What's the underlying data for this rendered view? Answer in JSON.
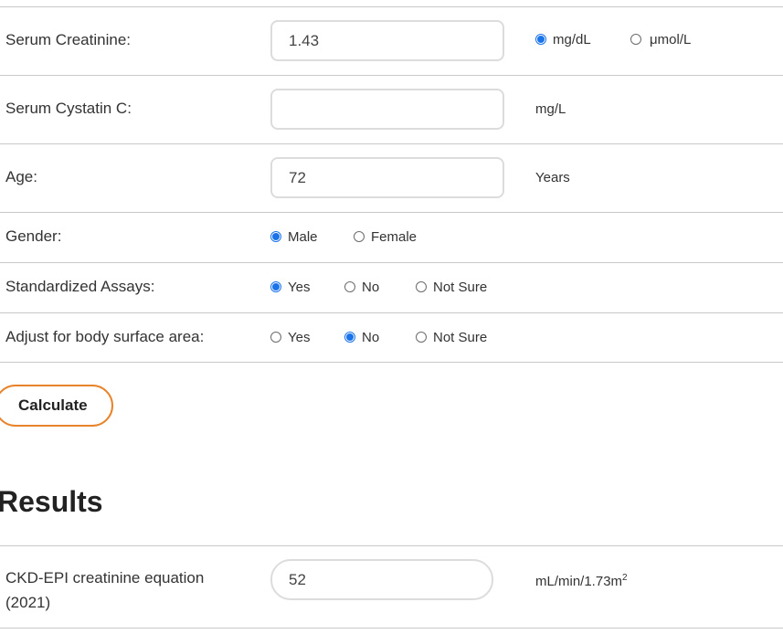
{
  "form": {
    "creatinine": {
      "label": "Serum Creatinine:",
      "value": "1.43",
      "unit_options": [
        {
          "label": "mg/dL",
          "checked": true
        },
        {
          "label": "μmol/L",
          "checked": false
        }
      ]
    },
    "cystatin": {
      "label": "Serum Cystatin C:",
      "value": "",
      "unit": "mg/L"
    },
    "age": {
      "label": "Age:",
      "value": "72",
      "unit": "Years"
    },
    "gender": {
      "label": "Gender:",
      "options": [
        {
          "label": "Male",
          "checked": true
        },
        {
          "label": "Female",
          "checked": false
        }
      ]
    },
    "assays": {
      "label": "Standardized Assays:",
      "options": [
        {
          "label": "Yes",
          "checked": true
        },
        {
          "label": "No",
          "checked": false
        },
        {
          "label": "Not Sure",
          "checked": false
        }
      ]
    },
    "bsa": {
      "label": "Adjust for body surface area:",
      "options": [
        {
          "label": "Yes",
          "checked": false
        },
        {
          "label": "No",
          "checked": true
        },
        {
          "label": "Not Sure",
          "checked": false
        }
      ]
    },
    "calculate_label": "Calculate"
  },
  "results": {
    "title": "Results",
    "ckd_epi": {
      "label_line1": "CKD-EPI creatinine equation",
      "label_line2": "(2021)",
      "value": "52",
      "unit_base": "mL/min/1.73m",
      "unit_sup": "2"
    }
  }
}
